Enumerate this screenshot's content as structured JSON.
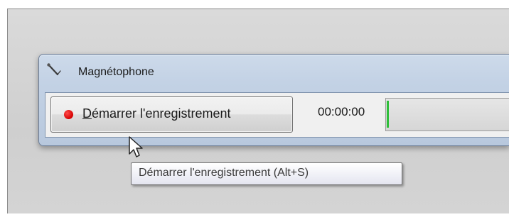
{
  "window": {
    "title": "Magnétophone",
    "icon": "microphone-icon"
  },
  "record_button": {
    "label_accel": "D",
    "label_rest": "émarrer l'enregistrement",
    "icon": "record-dot-icon",
    "color": "#e00000"
  },
  "timer": {
    "value": "00:00:00"
  },
  "level_meter": {
    "level": 0,
    "color": "#2fbf3a"
  },
  "tooltip": {
    "text": "Démarrer l'enregistrement (Alt+S)"
  },
  "cursor": {
    "icon": "arrow-cursor-icon"
  }
}
